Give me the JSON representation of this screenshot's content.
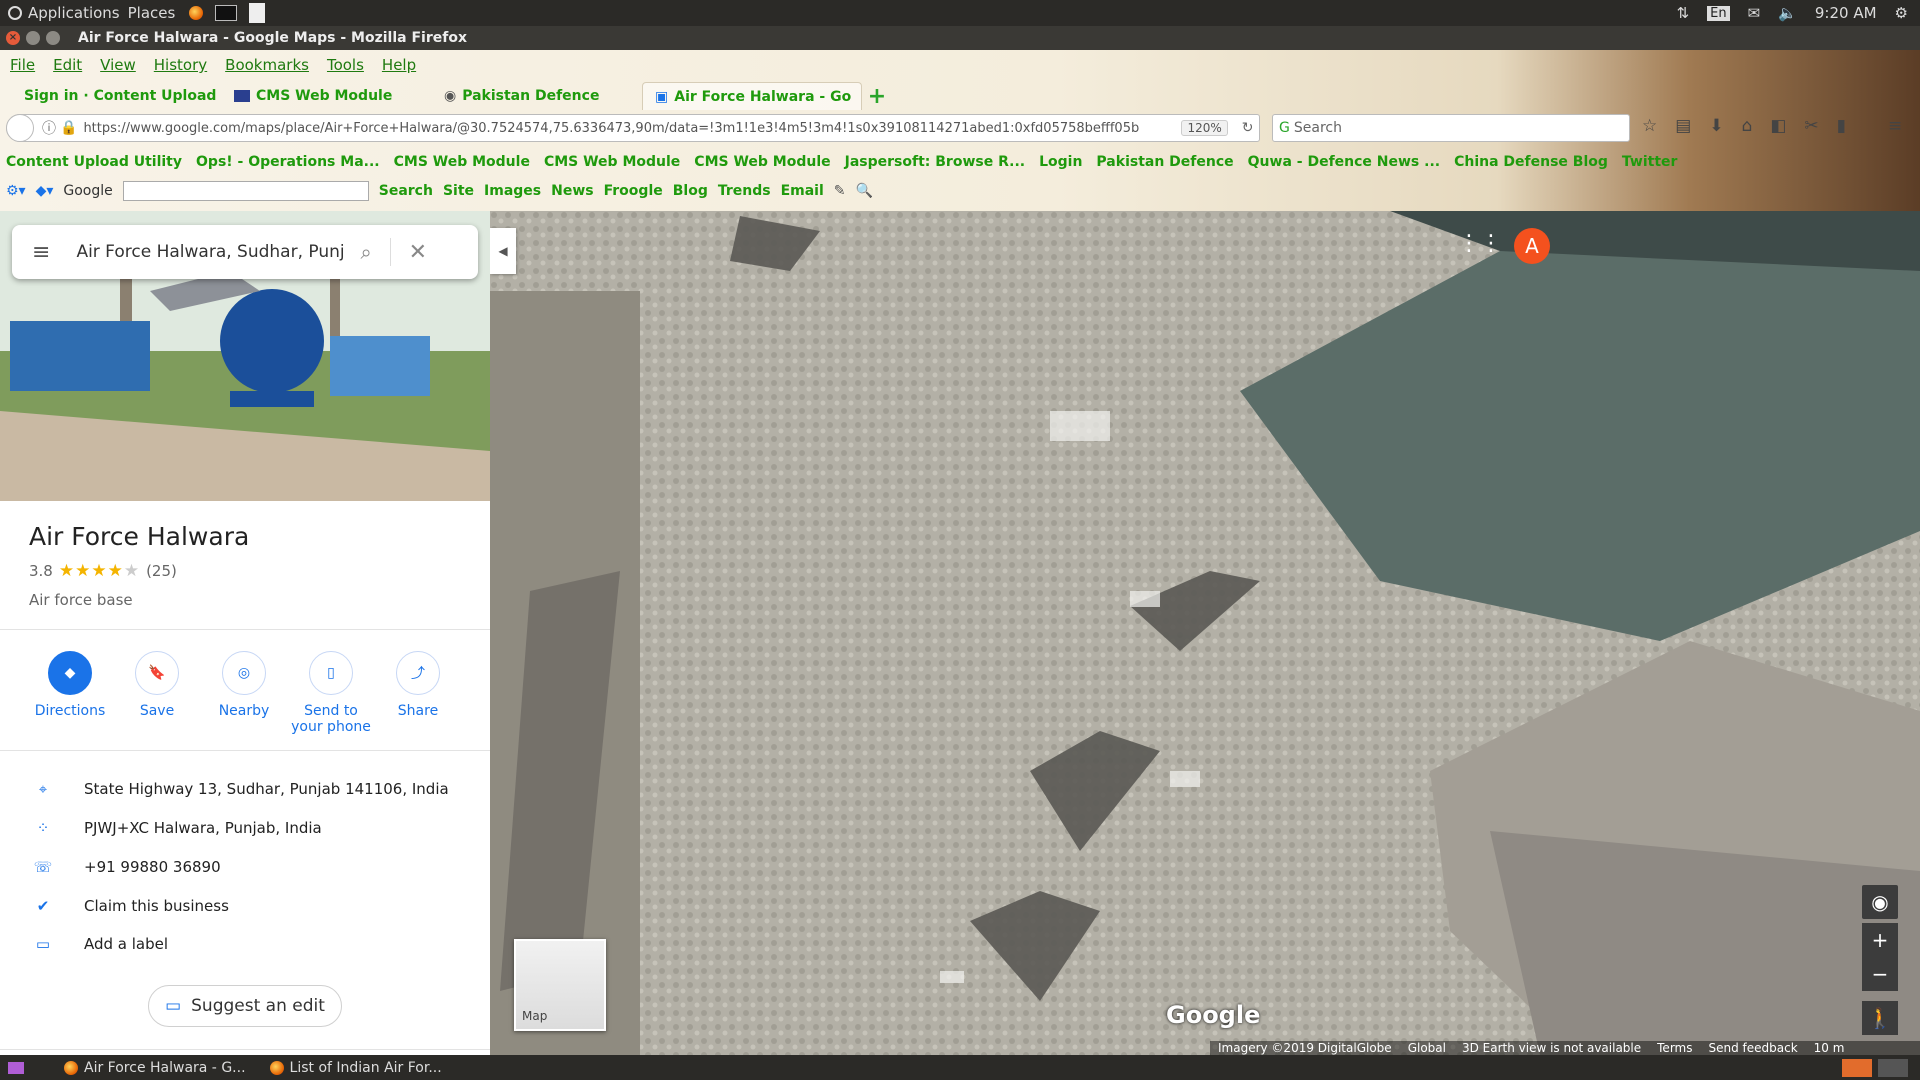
{
  "topbar": {
    "applications": "Applications",
    "places": "Places",
    "lang": "En",
    "time": "9:20 AM"
  },
  "window": {
    "title": "Air Force Halwara - Google Maps - Mozilla Firefox"
  },
  "menu": [
    "File",
    "Edit",
    "View",
    "History",
    "Bookmarks",
    "Tools",
    "Help"
  ],
  "tabs": [
    {
      "label": "Sign in · Content Upload U"
    },
    {
      "label": "CMS Web Module"
    },
    {
      "label": "Pakistan Defence"
    },
    {
      "label": "Air Force Halwara - Go"
    }
  ],
  "url": {
    "value": "https://www.google.com/maps/place/Air+Force+Halwara/@30.7524574,75.6336473,90m/data=!3m1!1e3!4m5!3m4!1s0x39108114271abed1:0xfd05758befff05b",
    "zoom": "120%",
    "search_placeholder": "Search"
  },
  "bookmarks": [
    "Content Upload Utility",
    "Ops! - Operations Ma...",
    "CMS Web Module",
    "CMS Web Module",
    "CMS Web Module",
    "Jaspersoft: Browse R...",
    "Login",
    "Pakistan Defence",
    "Quwa - Defence News ...",
    "China Defense Blog",
    "Twitter"
  ],
  "google_toolbar": {
    "brand": "Google",
    "items": [
      "Search",
      "Site",
      "Images",
      "News",
      "Froogle",
      "Blog",
      "Trends",
      "Email"
    ]
  },
  "maps": {
    "search_value": "Air Force Halwara, Sudhar, Punjab",
    "place_title": "Air Force Halwara",
    "rating": "3.8",
    "reviews": "(25)",
    "category": "Air force base",
    "actions": [
      {
        "label": "Directions"
      },
      {
        "label": "Save"
      },
      {
        "label": "Nearby"
      },
      {
        "label": "Send to your phone"
      },
      {
        "label": "Share"
      }
    ],
    "info": {
      "address": "State Highway 13, Sudhar, Punjab 141106, India",
      "pluscode": "PJWJ+XC Halwara, Punjab, India",
      "phone": "+91 99880 36890",
      "claim": "Claim this business",
      "label": "Add a label"
    },
    "suggest": "Suggest an edit",
    "avatar": "A",
    "minimap": "Map",
    "logo": "Google",
    "footer": [
      "Imagery ©2019 DigitalGlobe",
      "Global",
      "3D Earth view is not available",
      "Terms",
      "Send feedback",
      "10 m"
    ]
  },
  "taskbar": [
    {
      "label": "Air Force Halwara - G..."
    },
    {
      "label": "List of Indian Air For..."
    }
  ],
  "colors": {
    "accent": "#1a73e8",
    "bookmark_green": "#1f9a0d",
    "star": "#f4b400",
    "avatar": "#f4511e"
  }
}
